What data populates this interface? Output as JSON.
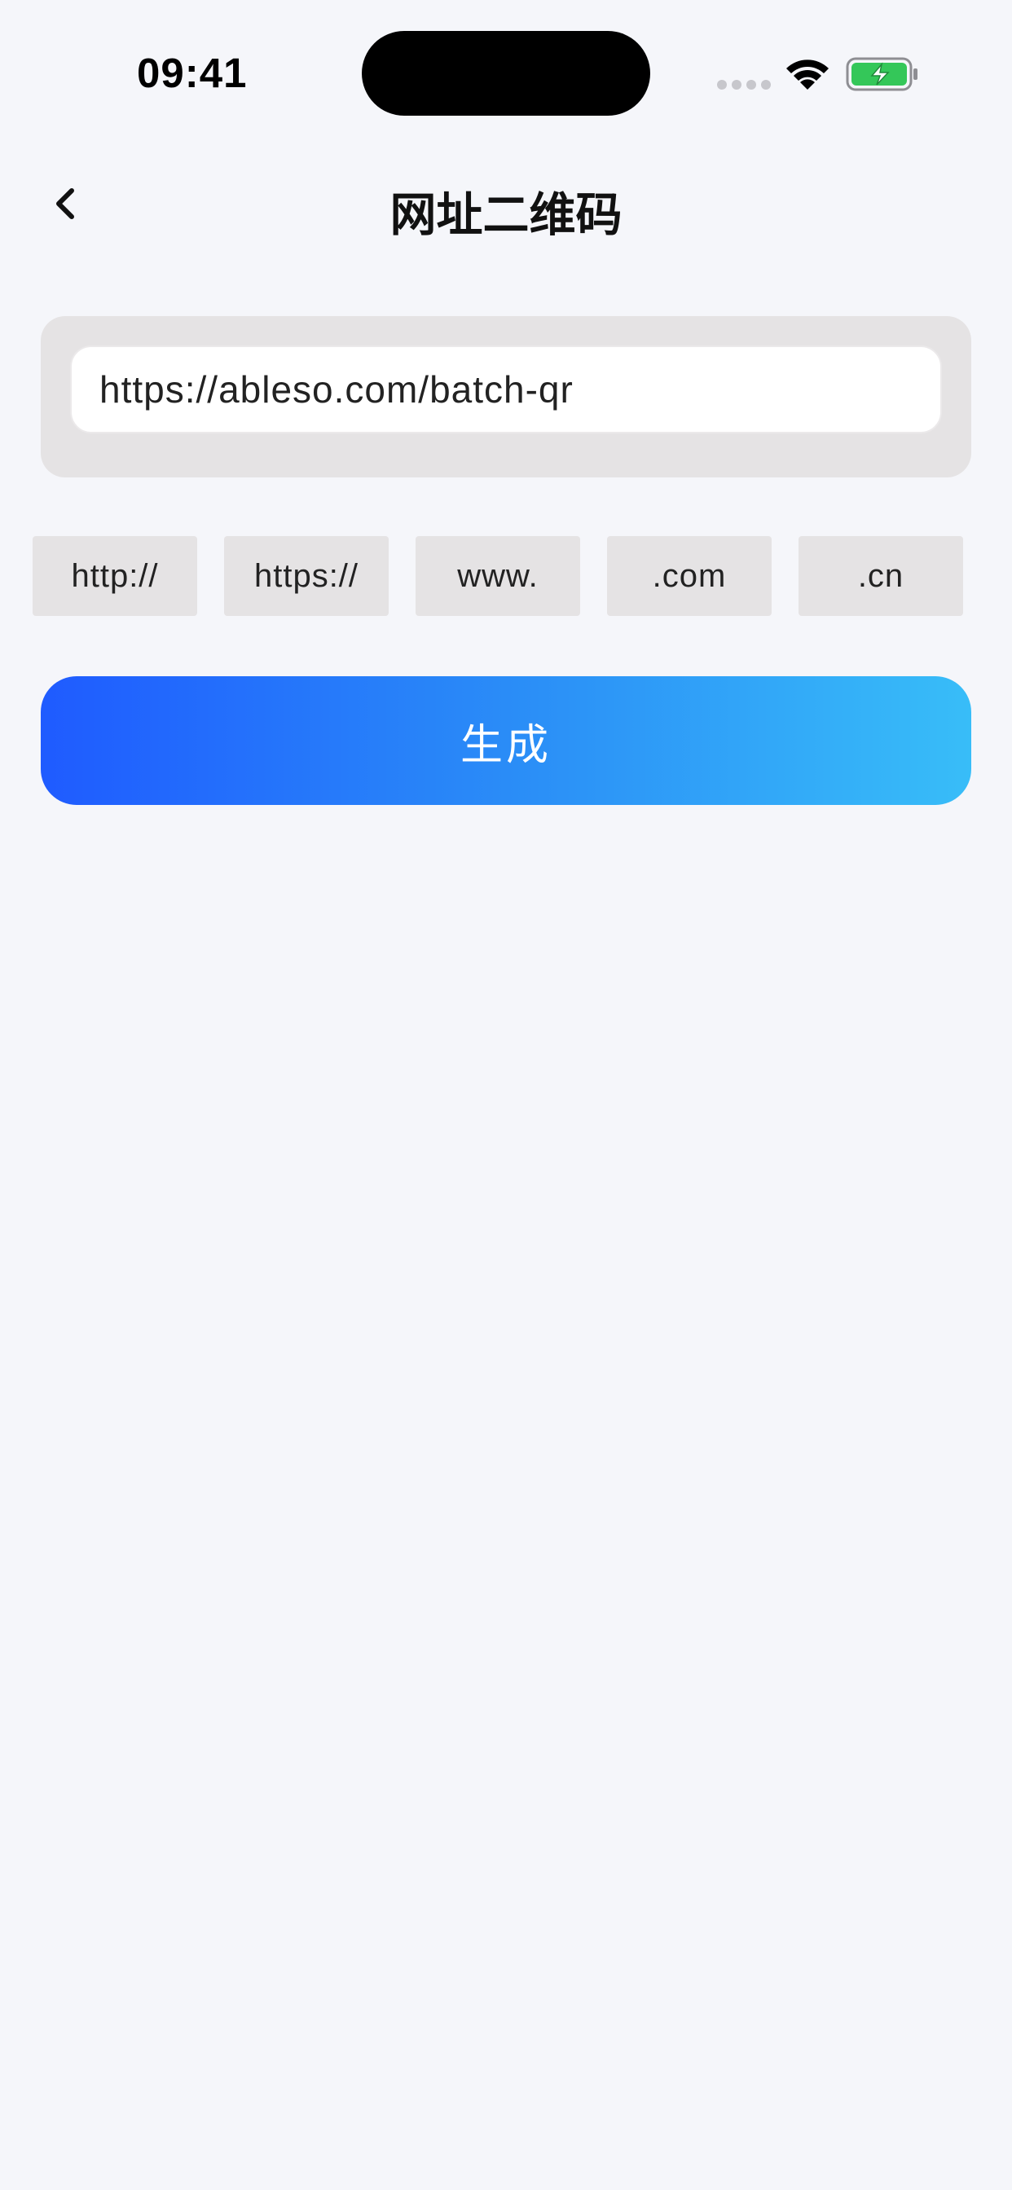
{
  "status_bar": {
    "time": "09:41"
  },
  "nav": {
    "title": "网址二维码",
    "back_icon": "chevron-left-icon"
  },
  "url_input": {
    "value": "https://ableso.com/batch-qr",
    "placeholder": ""
  },
  "chips": [
    {
      "label": "http://"
    },
    {
      "label": "https://"
    },
    {
      "label": "www."
    },
    {
      "label": ".com"
    },
    {
      "label": ".cn"
    }
  ],
  "generate_button": {
    "label": "生成"
  },
  "colors": {
    "background": "#f5f6fa",
    "card": "#e5e3e4",
    "gradient_start": "#1f5bff",
    "gradient_end": "#38bdf8",
    "battery_green": "#34c759"
  }
}
